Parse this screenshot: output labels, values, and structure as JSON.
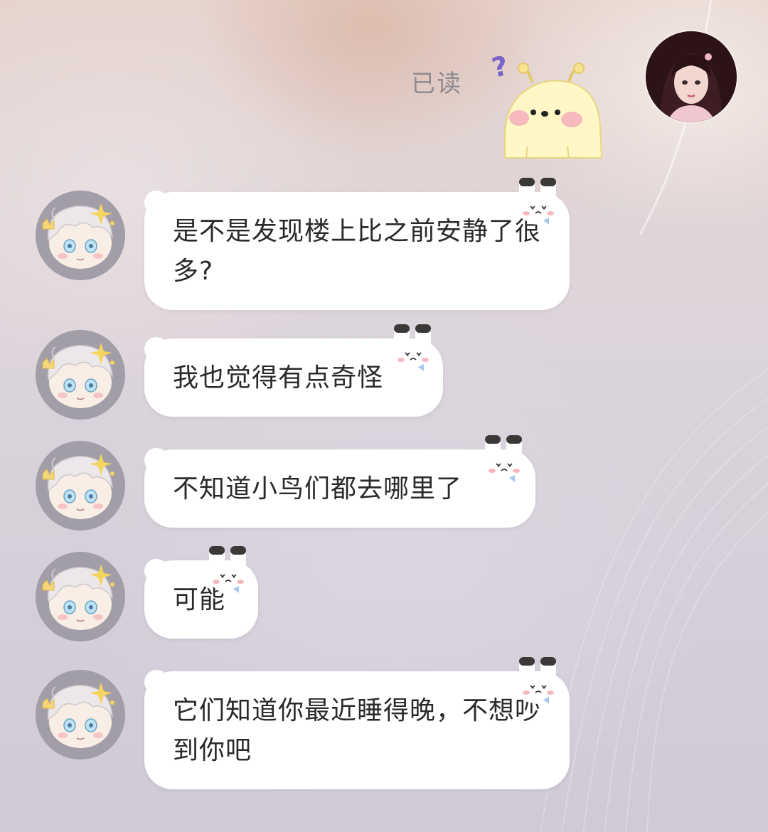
{
  "header": {
    "read_status": "已读",
    "question_mark": "?",
    "sticker_icon": "yellow-chick-sticker",
    "self_avatar_icon": "user-avatar-girl"
  },
  "messages": [
    {
      "sender": "peer",
      "text": "是不是发现楼上比之前安静了很多?"
    },
    {
      "sender": "peer",
      "text": "我也觉得有点奇怪"
    },
    {
      "sender": "peer",
      "text": "不知道小鸟们都去哪里了"
    },
    {
      "sender": "peer",
      "text": "可能"
    },
    {
      "sender": "peer",
      "text": "它们知道你最近睡得晚，不想吵到你吧"
    }
  ],
  "theme": {
    "bubble_color": "#ffffff",
    "text_color": "#2a2a2a",
    "read_status_color": "#8d8a93",
    "accent": "#7a63c9"
  }
}
